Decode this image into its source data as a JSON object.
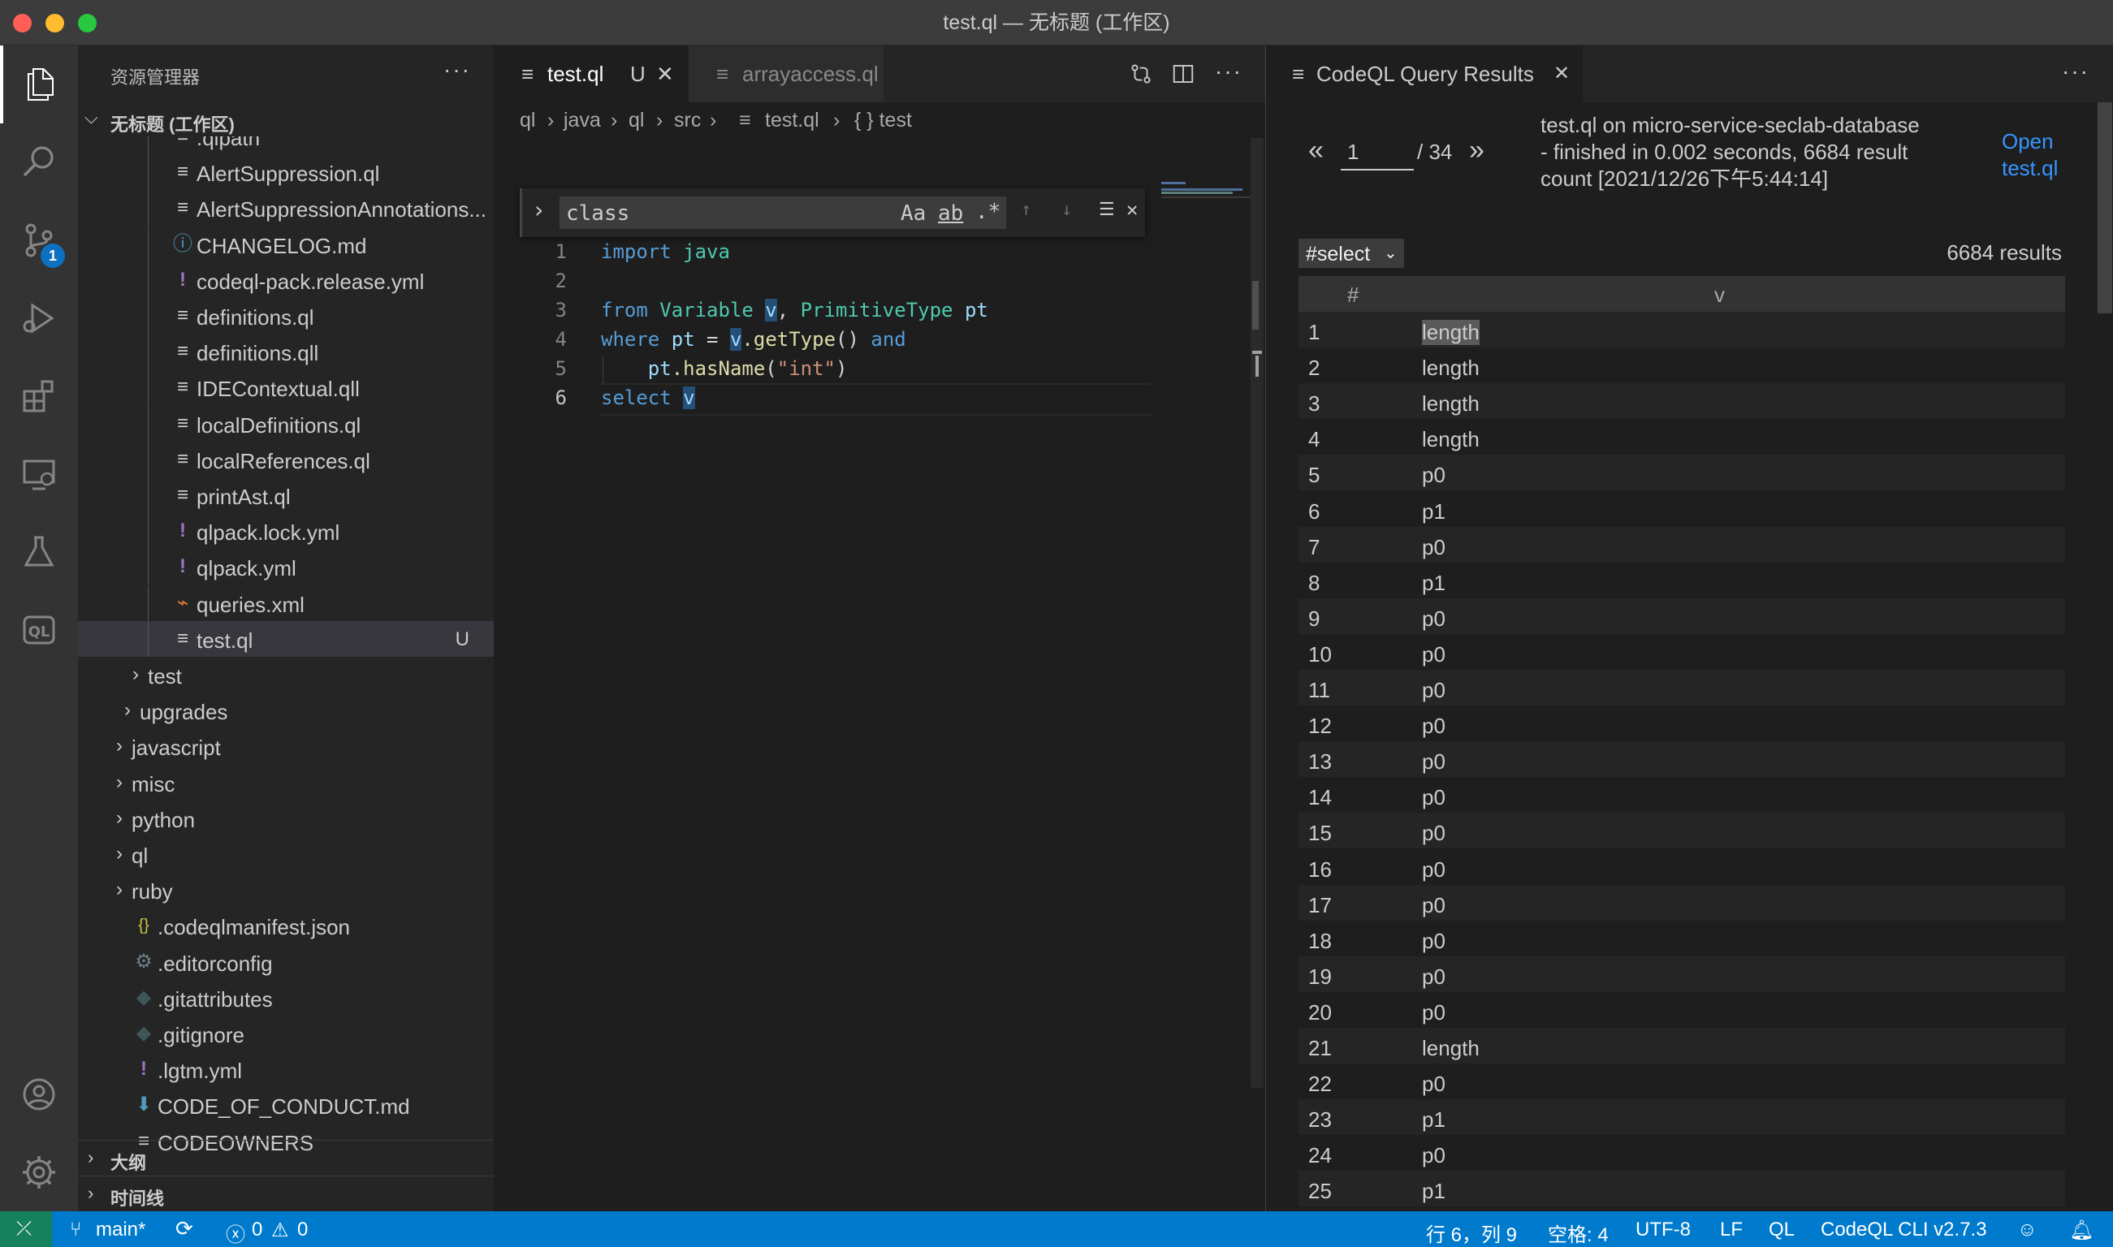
{
  "window": {
    "title": "test.ql — 无标题 (工作区)"
  },
  "sidebar": {
    "title": "资源管理器",
    "more": "···",
    "workspace": "无标题 (工作区)",
    "items": [
      {
        "name": ".qlpath",
        "icon": "lines"
      },
      {
        "name": "AlertSuppression.ql",
        "icon": "lines"
      },
      {
        "name": "AlertSuppressionAnnotations...",
        "icon": "lines"
      },
      {
        "name": "CHANGELOG.md",
        "icon": "info"
      },
      {
        "name": "codeql-pack.release.yml",
        "icon": "bang"
      },
      {
        "name": "definitions.ql",
        "icon": "lines"
      },
      {
        "name": "definitions.qll",
        "icon": "lines"
      },
      {
        "name": "IDEContextual.qll",
        "icon": "lines"
      },
      {
        "name": "localDefinitions.ql",
        "icon": "lines"
      },
      {
        "name": "localReferences.ql",
        "icon": "lines"
      },
      {
        "name": "printAst.ql",
        "icon": "lines"
      },
      {
        "name": "qlpack.lock.yml",
        "icon": "bang"
      },
      {
        "name": "qlpack.yml",
        "icon": "bang"
      },
      {
        "name": "queries.xml",
        "icon": "rss"
      },
      {
        "name": "test.ql",
        "icon": "lines",
        "git": "U"
      },
      {
        "name": "test",
        "icon": "folder"
      },
      {
        "name": "upgrades",
        "icon": "folder"
      },
      {
        "name": "javascript",
        "icon": "folder"
      },
      {
        "name": "misc",
        "icon": "folder"
      },
      {
        "name": "python",
        "icon": "folder"
      },
      {
        "name": "ql",
        "icon": "folder"
      },
      {
        "name": "ruby",
        "icon": "folder"
      },
      {
        "name": ".codeqlmanifest.json",
        "icon": "braces"
      },
      {
        "name": ".editorconfig",
        "icon": "gear"
      },
      {
        "name": ".gitattributes",
        "icon": "diamond"
      },
      {
        "name": ".gitignore",
        "icon": "diamond"
      },
      {
        "name": ".lgtm.yml",
        "icon": "bang"
      },
      {
        "name": "CODE_OF_CONDUCT.md",
        "icon": "down"
      },
      {
        "name": "CODEOWNERS",
        "icon": "lines"
      }
    ],
    "outline": "大纲",
    "timeline": "时间线"
  },
  "editor": {
    "tabs": [
      {
        "label": "test.ql",
        "status": "U"
      },
      {
        "label": "arrayaccess.ql"
      }
    ],
    "breadcrumbs": [
      "ql",
      "java",
      "ql",
      "src",
      "test.ql",
      "{ } test"
    ],
    "find": {
      "query": "class",
      "match_case": "Aa",
      "whole_word": "ab",
      "regex": ".*"
    },
    "line_numbers": [
      "1",
      "2",
      "3",
      "4",
      "5",
      "6"
    ],
    "code": {
      "l1_kw": "import",
      "l1_rest": " java",
      "l3_kw": "from",
      "l3_t1": "Variable",
      "l3_v1": "v",
      "l3_c": ", ",
      "l3_t2": "PrimitiveType",
      "l3_v2": "pt",
      "l4_kw": "where",
      "l4_v1": "pt",
      "l4_eq": " = ",
      "l4_v2": "v",
      "l4_fn": ".getType",
      "l4_p": "() ",
      "l4_and": "and",
      "l5_v": "pt",
      "l5_fn": ".hasName",
      "l5_o": "(",
      "l5_s": "\"int\"",
      "l5_c": ")",
      "l6_kw": "select",
      "l6_v": "v"
    }
  },
  "results": {
    "tab_label": "CodeQL Query Results",
    "page": "1",
    "total_pages": "/ 34",
    "info": [
      "test.ql on micro-service-seclab-database",
      "- finished in 0.002 seconds, 6684 result",
      "count [2021/12/26下午5:44:14]"
    ],
    "open_link": [
      "Open",
      "test.ql"
    ],
    "select": "#select",
    "count": "6684 results",
    "columns": [
      "#",
      "v"
    ],
    "rows": [
      [
        "1",
        "length"
      ],
      [
        "2",
        "length"
      ],
      [
        "3",
        "length"
      ],
      [
        "4",
        "length"
      ],
      [
        "5",
        "p0"
      ],
      [
        "6",
        "p1"
      ],
      [
        "7",
        "p0"
      ],
      [
        "8",
        "p1"
      ],
      [
        "9",
        "p0"
      ],
      [
        "10",
        "p0"
      ],
      [
        "11",
        "p0"
      ],
      [
        "12",
        "p0"
      ],
      [
        "13",
        "p0"
      ],
      [
        "14",
        "p0"
      ],
      [
        "15",
        "p0"
      ],
      [
        "16",
        "p0"
      ],
      [
        "17",
        "p0"
      ],
      [
        "18",
        "p0"
      ],
      [
        "19",
        "p0"
      ],
      [
        "20",
        "p0"
      ],
      [
        "21",
        "length"
      ],
      [
        "22",
        "p0"
      ],
      [
        "23",
        "p1"
      ],
      [
        "24",
        "p0"
      ],
      [
        "25",
        "p1"
      ]
    ]
  },
  "status": {
    "branch": "main*",
    "errors": "0",
    "warnings": "0",
    "position": "行 6，列 9",
    "spaces": "空格: 4",
    "encoding": "UTF-8",
    "eol": "LF",
    "language": "QL",
    "cli": "CodeQL CLI v2.7.3"
  },
  "colors": {
    "accent": "#007acc",
    "remote": "#16825d",
    "link": "#3794ff",
    "badge": "#0e70c0"
  }
}
